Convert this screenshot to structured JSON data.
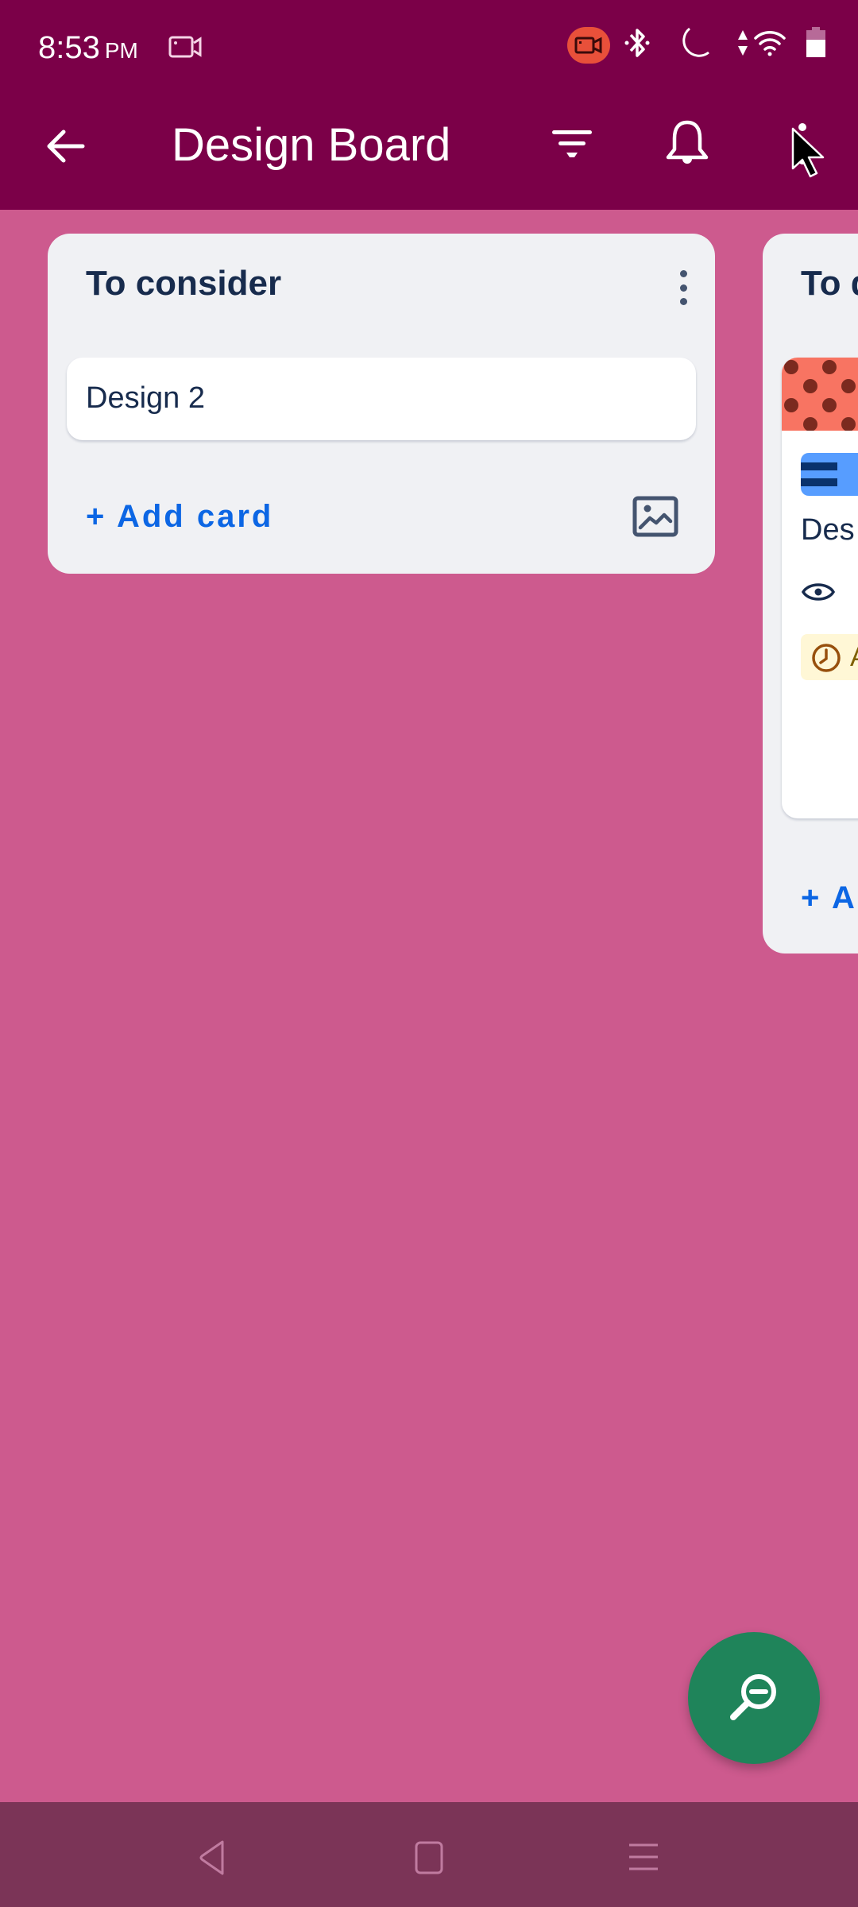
{
  "status_bar": {
    "time": "8:53",
    "ampm": "PM",
    "icons": [
      "screen-record-icon",
      "recording-active-icon",
      "bluetooth-icon",
      "do-not-disturb-moon-icon",
      "data-arrows-icon",
      "wifi-icon",
      "battery-icon"
    ]
  },
  "app_bar": {
    "title": "Design Board",
    "back_icon": "arrow-left-icon",
    "filter_icon": "filter-icon",
    "notifications_icon": "bell-icon",
    "more_icon": "more-vertical-icon"
  },
  "lists": [
    {
      "title": "To consider",
      "cards": [
        {
          "title": "Design 2"
        }
      ],
      "add_card_label": "+ Add card",
      "image_icon": "image-icon"
    },
    {
      "title": "To do",
      "title_visible": "To d",
      "cards": [
        {
          "cover_color": "#f87462",
          "label_color": "#579dff",
          "title_visible": "Des",
          "watch_icon": "eye-icon",
          "due_visible": "A",
          "due_icon": "clock-icon"
        }
      ],
      "add_card_label": "+ A"
    }
  ],
  "fab": {
    "icon": "zoom-out-icon"
  },
  "nav_bar": {
    "buttons": [
      "back-triangle-icon",
      "home-square-icon",
      "recents-menu-icon"
    ]
  },
  "colors": {
    "header": "#7b0048",
    "board_bg": "#cd5a8e",
    "list_bg": "#f0f1f4",
    "link": "#0c66e4",
    "fab": "#1f845a",
    "nav_bar": "#7b3457"
  }
}
